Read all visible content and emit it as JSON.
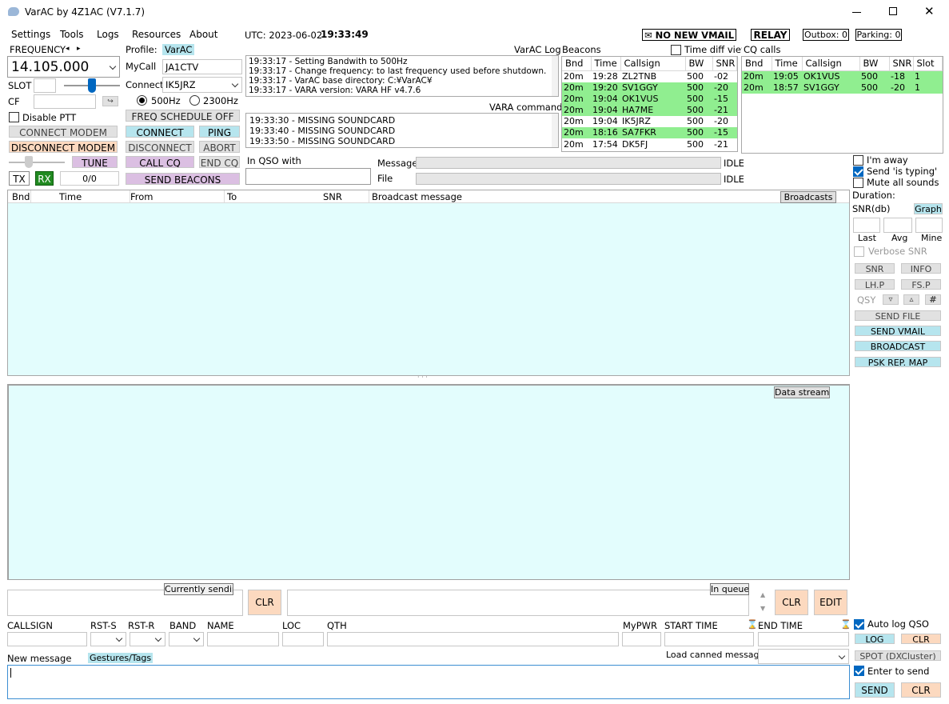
{
  "window": {
    "title": "VarAC by 4Z1AC (V7.1.7)"
  },
  "menu": [
    "Settings",
    "Tools",
    "Logs",
    "Resources",
    "About"
  ],
  "utc": {
    "label": "UTC: 2023-06-02",
    "time": "19:33:49"
  },
  "top_right": {
    "vmail": "✉ NO NEW VMAIL",
    "relay": "RELAY",
    "outbox": "Outbox: 0",
    "parking": "Parking: 0"
  },
  "frequency": {
    "label": "FREQUENCY",
    "value": "14.105.000"
  },
  "slot": {
    "label": "SLOT",
    "value": ""
  },
  "cf": {
    "label": "CF",
    "value": ""
  },
  "disable_ptt": "Disable PTT",
  "buttons_left": {
    "connect_modem": "CONNECT MODEM",
    "disconnect_modem": "DISCONNECT MODEM",
    "tune": "TUNE",
    "tx": "TX",
    "rx": "RX",
    "counter": "0/0"
  },
  "profile": {
    "label": "Profile:",
    "value": "VarAC"
  },
  "mycall": {
    "label": "MyCall",
    "value": "JA1CTV"
  },
  "connect": {
    "label": "Connect",
    "value": "IK5JRZ"
  },
  "bandwidth": {
    "opt1": "500Hz",
    "opt2": "2300Hz"
  },
  "buttons_mid": {
    "freq_schedule": "FREQ SCHEDULE OFF",
    "connect": "CONNECT",
    "ping": "PING",
    "disconnect": "DISCONNECT",
    "abort": "ABORT",
    "call_cq": "CALL CQ",
    "end_cq": "END CQ",
    "send_beacons": "SEND BEACONS"
  },
  "log": {
    "title": "VarAC Log",
    "lines": [
      "19:33:17 - Setting Bandwith to 500Hz",
      "19:33:17 - Change frequency: to last frequency used before shutdown.",
      "19:33:17 - VarAC base directory: C:¥VarAC¥",
      "19:33:17 - VARA version: VARA HF v4.7.6"
    ]
  },
  "vara": {
    "title": "VARA commands",
    "lines": [
      "19:33:30 - MISSING SOUNDCARD",
      "19:33:40 - MISSING SOUNDCARD",
      "19:33:50 - MISSING SOUNDCARD"
    ]
  },
  "in_qso": {
    "label": "In QSO with",
    "value": ""
  },
  "message": {
    "label": "Message",
    "status": "IDLE"
  },
  "file": {
    "label": "File",
    "status": "IDLE"
  },
  "beacons": {
    "title": "Beacons",
    "columns": [
      "Bnd",
      "Time",
      "Callsign",
      "BW",
      "SNR"
    ],
    "rows": [
      {
        "bnd": "20m",
        "time": "19:28",
        "call": "ZL2TNB",
        "bw": "500",
        "snr": "-02",
        "hl": false
      },
      {
        "bnd": "20m",
        "time": "19:20",
        "call": "SV1GGY",
        "bw": "500",
        "snr": "-20",
        "hl": true
      },
      {
        "bnd": "20m",
        "time": "19:04",
        "call": "OK1VUS",
        "bw": "500",
        "snr": "-15",
        "hl": true
      },
      {
        "bnd": "20m",
        "time": "19:04",
        "call": "HA7ME",
        "bw": "500",
        "snr": "-21",
        "hl": true
      },
      {
        "bnd": "20m",
        "time": "19:04",
        "call": "IK5JRZ",
        "bw": "500",
        "snr": "-20",
        "hl": false
      },
      {
        "bnd": "20m",
        "time": "18:16",
        "call": "SA7FKR",
        "bw": "500",
        "snr": "-15",
        "hl": true
      },
      {
        "bnd": "20m",
        "time": "17:54",
        "call": "DK5FJ",
        "bw": "500",
        "snr": "-21",
        "hl": false
      }
    ]
  },
  "time_diff": "Time diff view",
  "cq": {
    "title": "CQ calls",
    "columns": [
      "Bnd",
      "Time",
      "Callsign",
      "BW",
      "SNR",
      "Slot"
    ],
    "rows": [
      {
        "bnd": "20m",
        "time": "19:05",
        "call": "OK1VUS",
        "bw": "500",
        "snr": "-18",
        "slot": "1"
      },
      {
        "bnd": "20m",
        "time": "18:57",
        "call": "SV1GGY",
        "bw": "500",
        "snr": "-20",
        "slot": "1"
      }
    ]
  },
  "right_panel": {
    "away": "I'm away",
    "typing": "Send 'is typing'",
    "mute": "Mute all sounds",
    "duration": "Duration:",
    "snr_db": "SNR(db)",
    "graph": "Graph",
    "last": "Last",
    "avg": "Avg",
    "mine": "Mine",
    "verbose": "Verbose SNR",
    "snr": "SNR",
    "info": "INFO",
    "lhp": "LH.P",
    "fsp": "FS.P",
    "qsy": "QSY",
    "qsy_down": "▿",
    "qsy_up": "▵",
    "hash": "#",
    "send_file": "SEND FILE",
    "send_vmail": "SEND VMAIL",
    "broadcast": "BROADCAST",
    "psk": "PSK REP. MAP"
  },
  "broadcast_table": {
    "columns": [
      "Bnd",
      "Time",
      "From",
      "To",
      "SNR",
      "Broadcast message"
    ],
    "tag": "Broadcasts"
  },
  "data_stream": {
    "tag": "Data stream",
    "splitter": "· · ·"
  },
  "sending": {
    "current": "Currently sending",
    "queue": "In queue",
    "clr": "CLR",
    "edit": "EDIT",
    "up": "▲",
    "down": "▼"
  },
  "logform": {
    "callsign": "CALLSIGN",
    "rst_s": "RST-S",
    "rst_r": "RST-R",
    "band": "BAND",
    "name": "NAME",
    "loc": "LOC",
    "qth": "QTH",
    "mypwr": "MyPWR",
    "start": "START TIME",
    "end": "END TIME",
    "hourglass": "⌛",
    "auto_log": "Auto log QSO",
    "log": "LOG",
    "clr": "CLR",
    "spot": "SPOT (DXCluster)"
  },
  "new_message": {
    "label": "New message",
    "gestures": "Gestures/Tags",
    "canned": "Load canned message:",
    "enter_send": "Enter to send",
    "send": "SEND",
    "clr": "CLR"
  },
  "colors": {
    "cyan": "#b6e5ee",
    "pink": "#dbbfe2",
    "peach": "#fcd9bf",
    "green": "#90ee90",
    "pane_bg": "#e3fdfd"
  }
}
